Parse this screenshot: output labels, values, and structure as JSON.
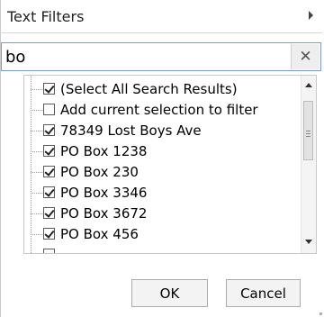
{
  "text_filters": {
    "label": "Text Filters"
  },
  "search": {
    "value": "bo",
    "clear_icon": "close-icon"
  },
  "list": {
    "items": [
      {
        "label": "(Select All Search Results)",
        "checked": true
      },
      {
        "label": "Add current selection to filter",
        "checked": false
      },
      {
        "label": "78349 Lost Boys Ave",
        "checked": true
      },
      {
        "label": "PO Box 1238",
        "checked": true
      },
      {
        "label": "PO Box 230",
        "checked": true
      },
      {
        "label": "PO Box 3346",
        "checked": true
      },
      {
        "label": "PO Box 3672",
        "checked": true
      },
      {
        "label": "PO Box 456",
        "checked": true
      }
    ]
  },
  "buttons": {
    "ok": "OK",
    "cancel": "Cancel"
  }
}
